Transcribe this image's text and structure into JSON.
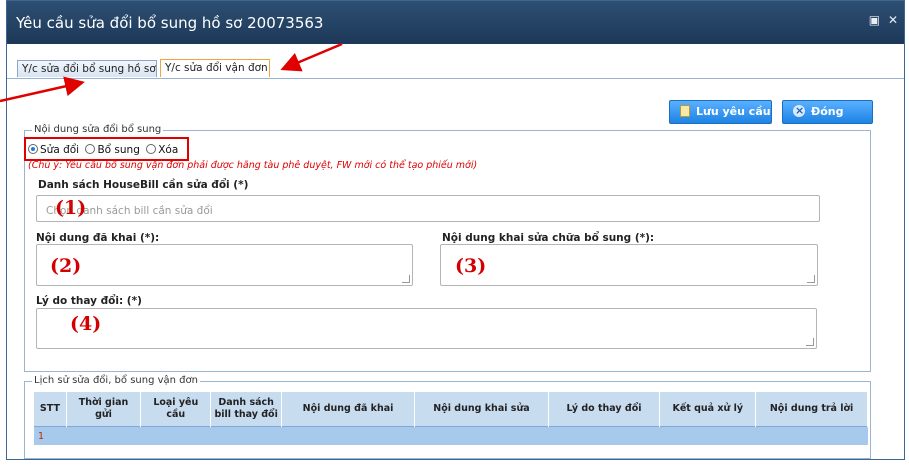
{
  "window": {
    "title": "Yêu cầu sửa đổi bổ sung hồ sơ 20073563",
    "controls": [
      "maximize-icon",
      "close-icon"
    ]
  },
  "tabs": [
    {
      "label": "Y/c sửa đổi bổ sung hồ sơ",
      "active": false
    },
    {
      "label": "Y/c sửa đổi vận đơn",
      "active": true
    }
  ],
  "toolbar": {
    "save_label": "Lưu yêu cầu",
    "close_label": "Đóng"
  },
  "content_group": {
    "legend": "Nội dung sửa đổi bổ sung",
    "options": [
      {
        "label": "Sửa đổi",
        "selected": true
      },
      {
        "label": "Bổ sung",
        "selected": false
      },
      {
        "label": "Xóa",
        "selected": false
      }
    ],
    "note": "(Chú ý: Yêu cầu bổ sung vận đơn phải được hãng tàu phê duyệt, FW mới có thể tạo phiếu mới)",
    "housebill_label": "Danh sách HouseBill cần sửa đổi (*)",
    "housebill_placeholder": "Chọn danh sách bill cần sửa đổi",
    "declared_label": "Nội dung đã khai (*):",
    "corrected_label": "Nội dung khai sửa chữa bổ sung (*):",
    "reason_label": "Lý do thay đổi: (*)"
  },
  "markers": [
    "(1)",
    "(2)",
    "(3)",
    "(4)"
  ],
  "history": {
    "legend": "Lịch sử sửa đổi, bổ sung vận đơn",
    "columns": [
      "STT",
      "Thời gian gửi",
      "Loại yêu cầu",
      "Danh sách bill thay đổi",
      "Nội dung đã khai",
      "Nội dung khai sửa",
      "Lý do thay đổi",
      "Kết quả xử lý",
      "Nội dung trả lời"
    ],
    "rows": [
      {
        "stt": "1"
      }
    ]
  },
  "colors": {
    "titlebar": "#2d4f73",
    "button": "#1d83e4",
    "highlight": "#e00000",
    "table_header": "#c8dcf0"
  }
}
